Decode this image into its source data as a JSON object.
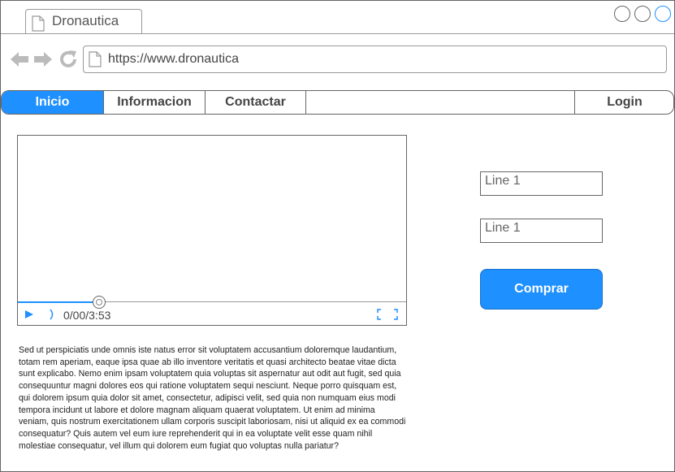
{
  "browser": {
    "tab_title": "Dronautica",
    "url": "https://www.dronautica"
  },
  "menu": {
    "items": [
      {
        "label": "Inicio"
      },
      {
        "label": "Informacion"
      },
      {
        "label": "Contactar"
      }
    ],
    "login_label": "Login",
    "active_color": "#1e90ff"
  },
  "video": {
    "time": "0/00/3:53",
    "progress": 0.21
  },
  "body_text": "Sed ut perspiciatis unde omnis iste natus error sit voluptatem accusantium doloremque laudantium, totam rem aperiam, eaque ipsa quae ab illo inventore veritatis et quasi architecto beatae vitae dicta sunt explicabo. Nemo enim ipsam voluptatem quia voluptas sit aspernatur aut odit aut fugit, sed quia consequuntur magni dolores eos qui ratione voluptatem sequi nesciunt. Neque porro quisquam est, qui dolorem ipsum quia dolor sit amet, consectetur, adipisci velit, sed quia non numquam eius modi tempora incidunt ut labore et dolore magnam aliquam quaerat voluptatem. Ut enim ad minima veniam, quis nostrum exercitationem ullam corporis suscipit laboriosam, nisi ut aliquid ex ea commodi consequatur? Quis autem vel eum iure reprehenderit qui in ea voluptate velit esse quam nihil molestiae consequatur, vel illum qui dolorem eum fugiat quo voluptas nulla pariatur?",
  "form": {
    "field1_value": "Line 1",
    "field2_value": "Line 1",
    "button_label": "Comprar"
  }
}
